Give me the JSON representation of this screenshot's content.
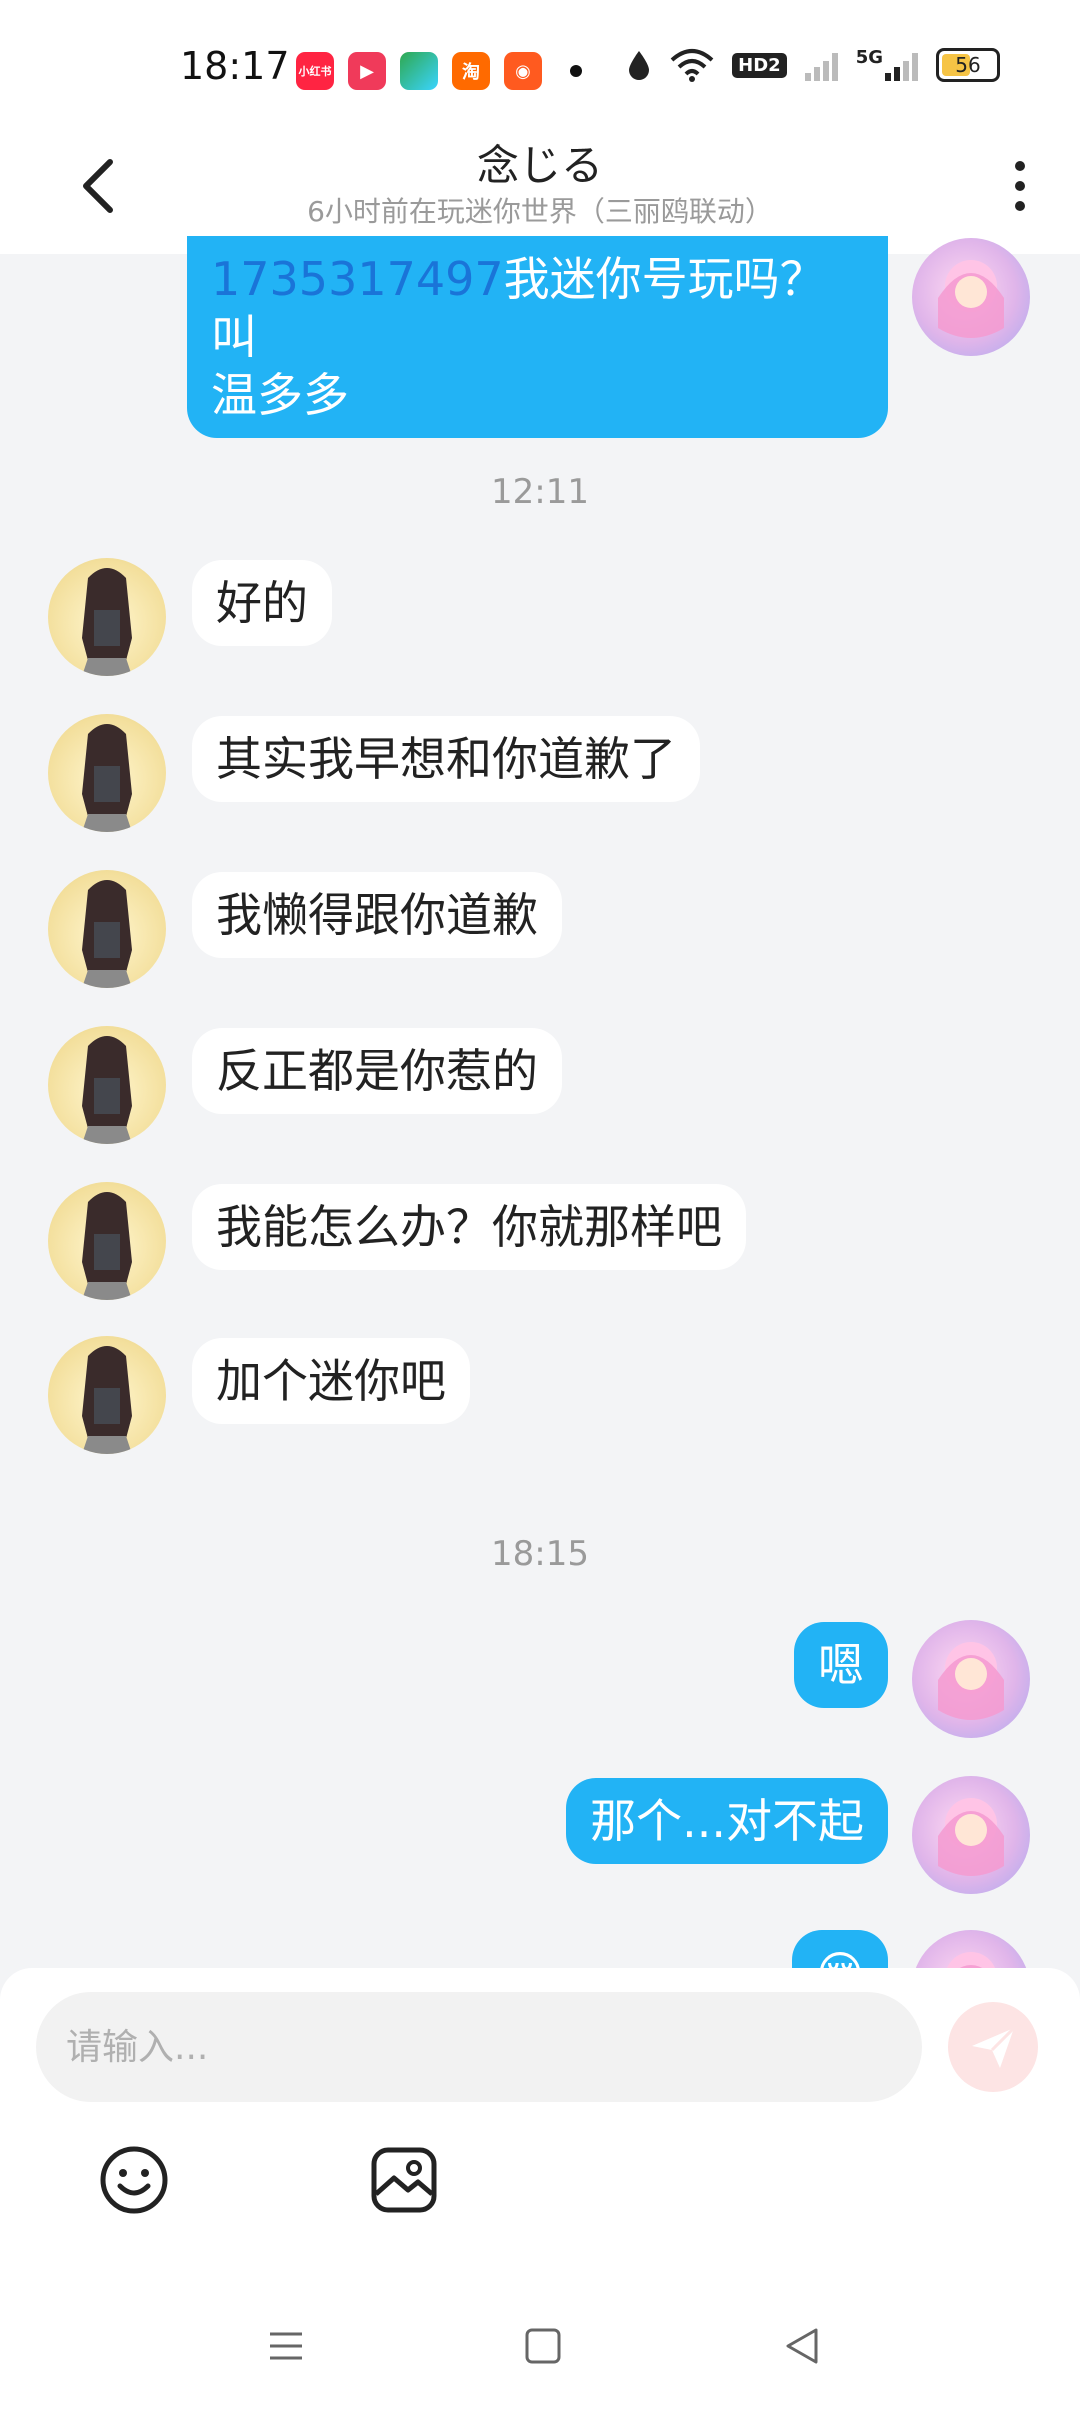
{
  "status_bar": {
    "time": "18:17",
    "app_icons": [
      {
        "name": "xiaohongshu-icon",
        "color": "#ff2442",
        "text": "小红书"
      },
      {
        "name": "video-play-icon",
        "color": "#f03a5a",
        "text": "▶"
      },
      {
        "name": "tencent-video-icon",
        "color": "#2fa84f",
        "text": ""
      },
      {
        "name": "taobao-icon",
        "color": "#ff6a00",
        "text": "淘"
      },
      {
        "name": "kuaishou-icon",
        "color": "#ff5a1f",
        "text": ""
      }
    ],
    "hd_label": "HD2",
    "network_label": "5G",
    "battery": "56"
  },
  "header": {
    "title": "念じる",
    "subtitle": "6小时前在玩迷你世界（三丽鸥联动）"
  },
  "messages": {
    "m0": {
      "prefix": "1735317497",
      "text": "我迷你号玩吗？叫\n温多多"
    },
    "ts1": "12:11",
    "m1": "好的",
    "m2": "其实我早想和你道歉了",
    "m3": "我懒得跟你道歉",
    "m4": "反正都是你惹的",
    "m5": "我能怎么办？你就那样吧",
    "m6": "加个迷你吧",
    "ts2": "18:15",
    "m7": "嗯",
    "m8": "那个...对不起",
    "m9": "😔"
  },
  "input": {
    "placeholder": "请输入..."
  },
  "colors": {
    "outgoing_bubble": "#22b3f5",
    "incoming_bubble": "#ffffff",
    "background": "#f3f4f6",
    "send_button": "#fde4e4"
  }
}
